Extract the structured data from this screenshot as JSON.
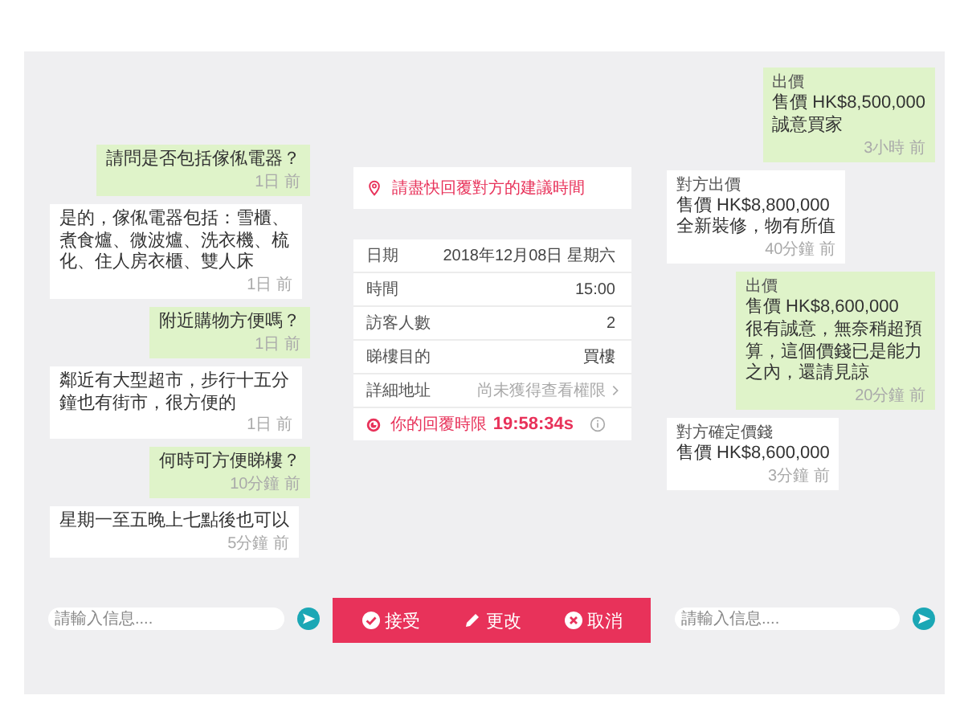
{
  "buyer_chat": {
    "messages": [
      {
        "sent": true,
        "text": "請問是否包括傢俬電器？",
        "time": "1日 前"
      },
      {
        "sent": false,
        "text": "是的，傢俬電器包括：雪櫃、煮食爐、微波爐、洗衣機、梳化、住人房衣櫃、雙人床",
        "time": "1日 前"
      },
      {
        "sent": true,
        "text": "附近購物方便嗎？",
        "time": "1日 前"
      },
      {
        "sent": false,
        "text": "鄰近有大型超市，步行十五分鐘也有街市，很方便的",
        "time": "1日 前"
      },
      {
        "sent": true,
        "text": "何時可方便睇樓？",
        "time": "10分鐘 前"
      },
      {
        "sent": false,
        "text": "星期一至五晚上七點後也可以",
        "time": "5分鐘 前"
      }
    ],
    "input": {
      "placeholder": "請輸入信息...."
    }
  },
  "viewing": {
    "notice": "請盡快回覆對方的建議時間",
    "details": [
      {
        "label": "日期",
        "value": "2018年12月08日 星期六",
        "kind": "plain"
      },
      {
        "label": "時間",
        "value": "15:00",
        "kind": "plain"
      },
      {
        "label": "訪客人數",
        "value": "2",
        "kind": "plain"
      },
      {
        "label": "睇樓目的",
        "value": "買樓",
        "kind": "plain"
      },
      {
        "label": "詳細地址",
        "value": "尚未獲得查看權限",
        "kind": "locked"
      }
    ],
    "deadline": {
      "label": "你的回覆時限",
      "value": "19:58:34s"
    },
    "actions": [
      {
        "label": "接受",
        "kind": "accept"
      },
      {
        "label": "更改",
        "kind": "edit"
      },
      {
        "label": "取消",
        "kind": "cancel"
      }
    ]
  },
  "offer_chat": {
    "messages": [
      {
        "sent": true,
        "heading": "出價",
        "price": "售價 HK$8,500,000",
        "note": "誠意買家",
        "time": "3小時 前"
      },
      {
        "sent": false,
        "heading": "對方出價",
        "price": "售價 HK$8,800,000",
        "note": "全新裝修，物有所值",
        "time": "40分鐘 前"
      },
      {
        "sent": true,
        "heading": "出價",
        "price": "售價 HK$8,600,000",
        "note": "很有誠意，無奈稍超預算，這個價錢已是能力之內，還請見諒",
        "time": "20分鐘 前"
      },
      {
        "sent": false,
        "heading": "對方確定價錢",
        "price": "售價 HK$8,600,000",
        "time": "3分鐘 前"
      }
    ],
    "input": {
      "placeholder": "請輸入信息...."
    }
  }
}
